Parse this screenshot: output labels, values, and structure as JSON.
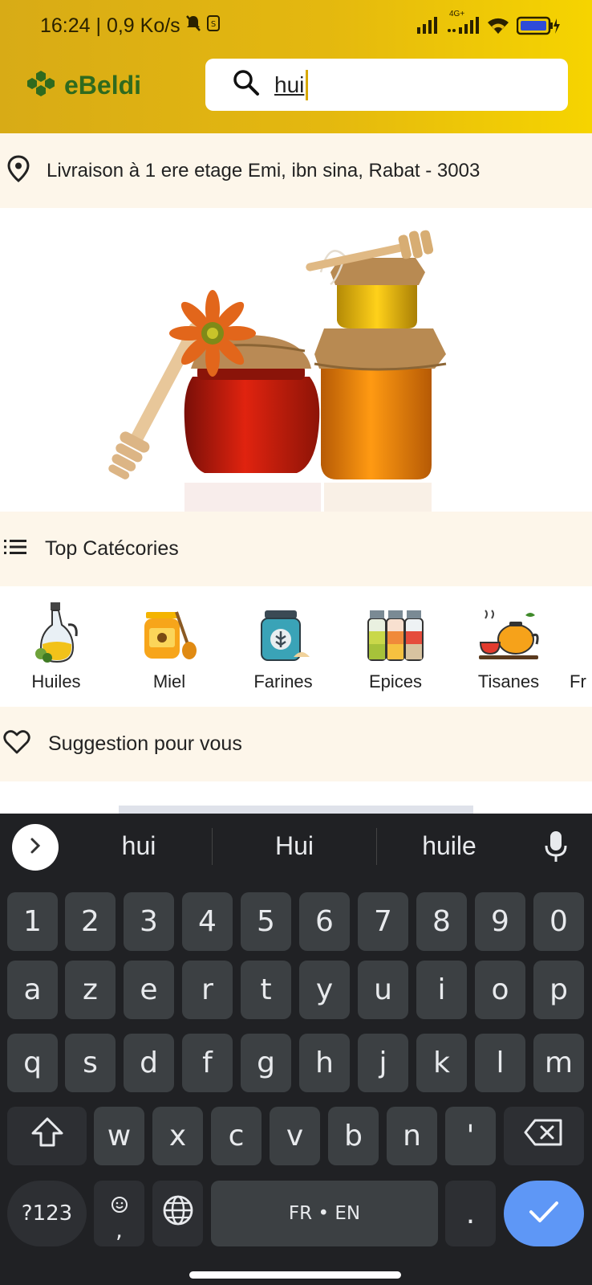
{
  "status": {
    "time_speed": "16:24 | 0,9 Ko/s",
    "network": "4G+"
  },
  "header": {
    "app_name": "eBeldi",
    "search_value": "hui"
  },
  "location": {
    "text": "Livraison à 1 ere etage Emi, ibn sina, Rabat - 3003"
  },
  "top_categories": {
    "title": "Top Catécories",
    "items": [
      {
        "label": "Huiles"
      },
      {
        "label": "Miel"
      },
      {
        "label": "Farines"
      },
      {
        "label": "Epices"
      },
      {
        "label": "Tisanes"
      },
      {
        "label": "Fr"
      }
    ]
  },
  "suggestions_section": {
    "title": "Suggestion pour vous"
  },
  "keyboard": {
    "suggestions": [
      "hui",
      "Hui",
      "huile"
    ],
    "row_numbers": [
      "1",
      "2",
      "3",
      "4",
      "5",
      "6",
      "7",
      "8",
      "9",
      "0"
    ],
    "row1": [
      "a",
      "z",
      "e",
      "r",
      "t",
      "y",
      "u",
      "i",
      "o",
      "p"
    ],
    "row2": [
      "q",
      "s",
      "d",
      "f",
      "g",
      "h",
      "j",
      "k",
      "l",
      "m"
    ],
    "row3": [
      "w",
      "x",
      "c",
      "v",
      "b",
      "n",
      "'"
    ],
    "symbols_key": "?123",
    "comma_key": ",",
    "space_label": "FR • EN",
    "period_key": "."
  },
  "colors": {
    "header_start": "#d8ab16",
    "header_end": "#f6d400",
    "brand_green": "#2f6a1e",
    "section_bg": "#fdf6ea",
    "keyboard_bg": "#202124",
    "key_bg": "#3c4043",
    "enter_blue": "#5e97f6"
  }
}
